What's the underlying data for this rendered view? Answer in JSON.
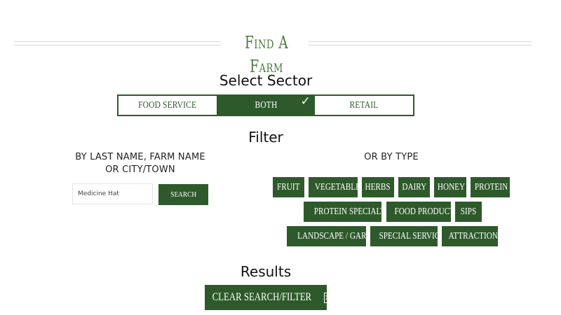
{
  "header": {
    "title": "Find A Farm"
  },
  "sector": {
    "heading": "Select Sector",
    "options": [
      {
        "label": "Food Service",
        "selected": false
      },
      {
        "label": "Both",
        "selected": true
      },
      {
        "label": "Retail",
        "selected": false
      }
    ],
    "check_glyph": "✓"
  },
  "filter": {
    "heading": "Filter",
    "name_label_line1": "BY LAST NAME, FARM NAME",
    "name_label_line2": "OR CITY/TOWN",
    "search_value": "Medicine Hat",
    "search_button": "Search",
    "type_label": "OR BY TYPE",
    "types": [
      "Fruit",
      "Vegetables",
      "Herbs",
      "Dairy",
      "Honey",
      "Protein",
      "Protein Specialties",
      "Food Products",
      "Sips",
      "Landscape / Garden",
      "Special Services",
      "Attractions"
    ]
  },
  "results": {
    "heading": "Results",
    "clear_button": "Clear Search/Filter",
    "clear_icon": "close-box-icon"
  },
  "colors": {
    "accent": "#2e5a2b",
    "title": "#4d7a3f",
    "background": "#ffffff"
  }
}
